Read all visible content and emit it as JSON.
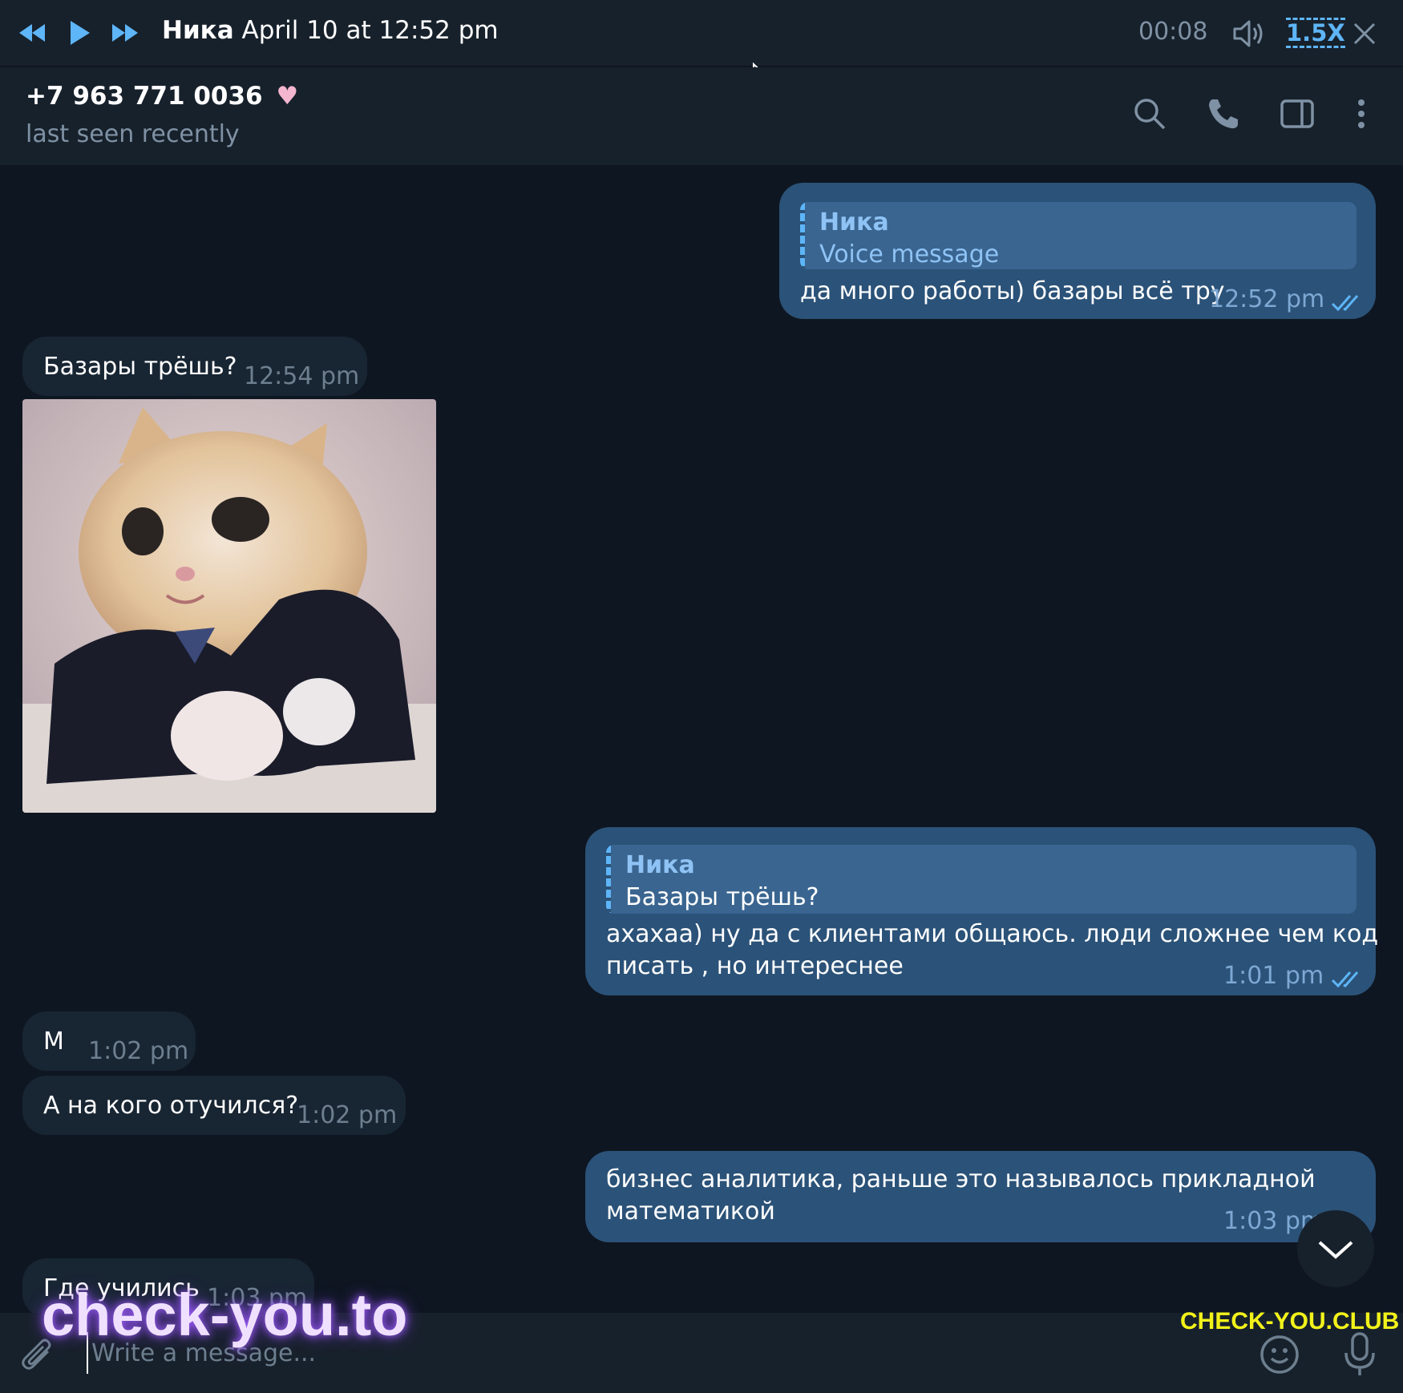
{
  "player": {
    "name": "Ника",
    "date": "April 10 at 12:52 pm",
    "elapsed": "00:08",
    "speed": "1.5X"
  },
  "header": {
    "title": "+7 963 771 0036",
    "status": "last seen recently"
  },
  "messages": [
    {
      "direction": "out",
      "reply_name": "Ника",
      "reply_text": "Voice message",
      "text": "да много работы) базары всё тру",
      "time": "12:52 pm"
    },
    {
      "direction": "in",
      "text": "Базары трёшь?",
      "time": "12:54 pm"
    },
    {
      "direction": "out",
      "reply_name": "Ника",
      "reply_text": "Базары трёшь?",
      "text_line1": "ахахаа) ну да с клиентами общаюсь. люди сложнее чем код",
      "text_line2": "писать , но интереснее",
      "time": "1:01 pm"
    },
    {
      "direction": "in",
      "text": "М",
      "time": "1:02 pm"
    },
    {
      "direction": "in",
      "text": "А на кого отучился?",
      "time": "1:02 pm"
    },
    {
      "direction": "out",
      "text_line1": "бизнес аналитика, раньше это называлось прикладной",
      "text_line2": "математикой",
      "time": "1:03 pm"
    },
    {
      "direction": "in",
      "text": "Где учились",
      "time": "1:03 pm"
    }
  ],
  "composer": {
    "placeholder": "Write a message..."
  },
  "watermarks": {
    "left": "check-you.to",
    "right": "CHECK-YOU.CLUB"
  },
  "colors": {
    "background": "#0e1621",
    "panel": "#17212b",
    "incoming": "#182533",
    "outgoing": "#2b5278",
    "accent": "#5eb5f7"
  }
}
